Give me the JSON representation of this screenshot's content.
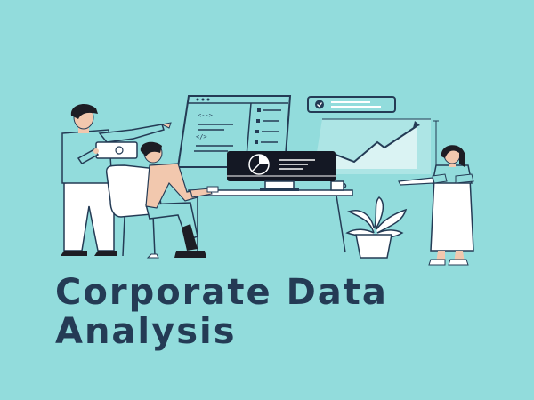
{
  "title": {
    "line1": "Corporate Data",
    "line2": "Analysis"
  },
  "illustration": {
    "icons": [
      "code-window-icon",
      "line-chart-icon",
      "check-icon",
      "pie-chart-icon",
      "plant-icon",
      "tablet-icon",
      "laptop-icon"
    ],
    "colors": {
      "background": "#92dcdc",
      "dark": "#243b55",
      "skin": "#f2c8ae",
      "hair": "#1d1d24",
      "white": "#ffffff"
    }
  }
}
